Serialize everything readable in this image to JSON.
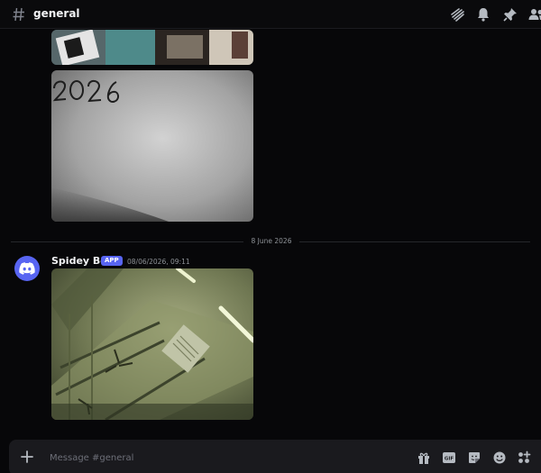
{
  "header": {
    "channel_name": "general",
    "icons": [
      "hash-icon",
      "threads-icon",
      "bell-icon",
      "pin-icon",
      "members-icon"
    ]
  },
  "messages": {
    "previous_images": [
      "camera-photo-top",
      "camera-photo-paper-2026"
    ],
    "date_divider": "8 June 2026",
    "latest": {
      "author": "Spidey Bot",
      "badge": "APP",
      "timestamp": "08/06/2026, 09:11",
      "avatar_icon": "discord-logo-icon",
      "image": "camera-photo-ceiling"
    }
  },
  "composer": {
    "placeholder": "Message #general",
    "value": "",
    "icons": [
      "plus-icon",
      "gift-icon",
      "gif-icon",
      "sticker-icon",
      "emoji-icon",
      "apps-icon"
    ]
  },
  "colors": {
    "background": "#070709",
    "accent": "#5865f2",
    "composer_bg": "#1a1a1e"
  }
}
